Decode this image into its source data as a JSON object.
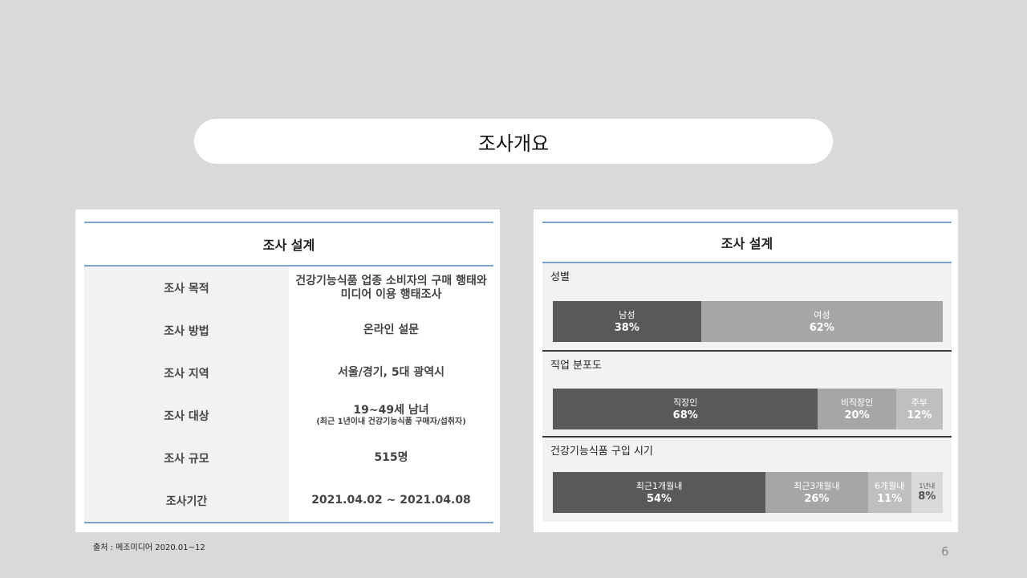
{
  "slide": {
    "title": "조사개요",
    "source": "출처 : 메조미디어 2020.01~12",
    "page_number": "6"
  },
  "left_panel": {
    "header": "조사 설계",
    "rows": [
      {
        "label": "조사 목적",
        "value": "건강기능식품 업종 소비자의 구매 행태와",
        "value2": "미디어 이용 행태조사"
      },
      {
        "label": "조사 방법",
        "value": "온라인 설문"
      },
      {
        "label": "조사 지역",
        "value": "서울/경기, 5대 광역시"
      },
      {
        "label": "조사 대상",
        "value": "19~49세 남녀",
        "sub": "(최근 1년이내 건강기능식품 구매자/섭취자)"
      },
      {
        "label": "조사 규모",
        "value": "515명"
      },
      {
        "label": "조사기간",
        "value": "2021.04.02 ~ 2021.04.08"
      }
    ]
  },
  "right_panel": {
    "header": "조사 설계",
    "colors": {
      "dark": "#595959",
      "mid": "#a6a6a6",
      "light": "#bfbfbf",
      "lightest": "#d9d9d9"
    },
    "chart_data": [
      {
        "type": "bar",
        "title": "성별",
        "categories": [
          "남성",
          "여성"
        ],
        "values": [
          38,
          62
        ],
        "labels": [
          "38%",
          "62%"
        ]
      },
      {
        "type": "bar",
        "title": "직업 분포도",
        "categories": [
          "직장인",
          "비직장인",
          "주부"
        ],
        "values": [
          68,
          20,
          12
        ],
        "labels": [
          "68%",
          "20%",
          "12%"
        ]
      },
      {
        "type": "bar",
        "title": "건강기능식품  구입 시기",
        "categories": [
          "최근1개월내",
          "최근3개월내",
          "6개월내",
          "1년내"
        ],
        "values": [
          54,
          26,
          11,
          8
        ],
        "labels": [
          "54%",
          "26%",
          "11%",
          "8%"
        ]
      }
    ]
  }
}
